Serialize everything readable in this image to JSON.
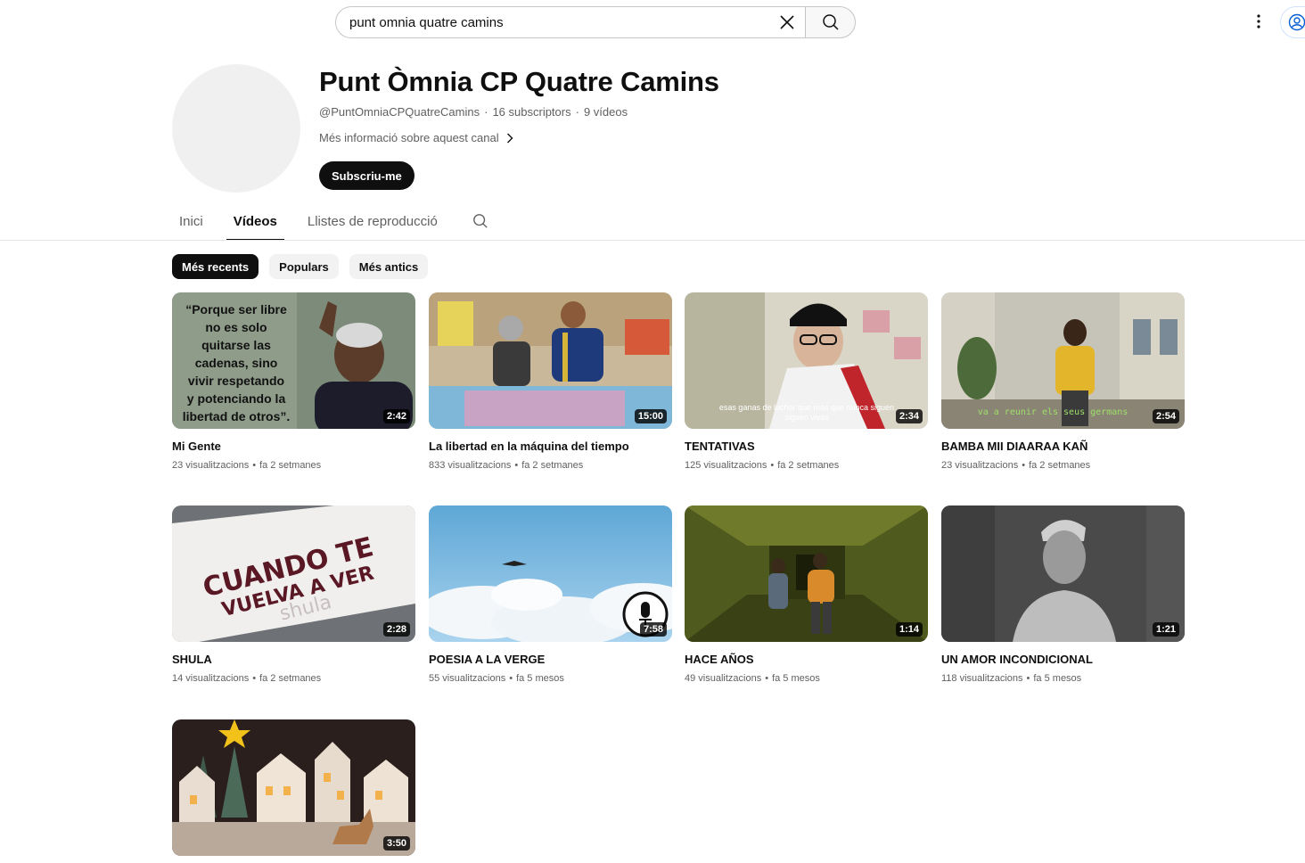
{
  "search": {
    "value": "punt omnia quatre camins"
  },
  "channel": {
    "title": "Punt Òmnia CP Quatre Camins",
    "handle": "@PuntOmniaCPQuatreCamins",
    "subscribers": "16 subscriptors",
    "video_count": "9 vídeos",
    "more_info": "Més informació sobre aquest canal",
    "subscribe_label": "Subscriu-me"
  },
  "tabs": [
    {
      "label": "Inici"
    },
    {
      "label": "Vídeos"
    },
    {
      "label": "Llistes de reproducció"
    }
  ],
  "chips": [
    {
      "label": "Més recents"
    },
    {
      "label": "Populars"
    },
    {
      "label": "Més antics"
    }
  ],
  "videos": [
    {
      "title": "Mi Gente",
      "views": "23 visualitzacions",
      "age": "fa 2 setmanes",
      "duration": "2:42",
      "thumb_text": [
        "“Porque ser libre",
        "no es solo",
        "quitarse las",
        "cadenas, sino",
        "vivir  respetando",
        "y  potenciando la",
        "libertad de otros”."
      ]
    },
    {
      "title": "La libertad en la máquina del tiempo",
      "views": "833 visualitzacions",
      "age": "fa 2 setmanes",
      "duration": "15:00"
    },
    {
      "title": "TENTATIVAS",
      "views": "125 visualitzacions",
      "age": "fa 2 setmanes",
      "duration": "2:34",
      "thumb_text": [
        "esas ganas de luchar que más que nunca siguen",
        "siguen vivas"
      ]
    },
    {
      "title": "BAMBA MII DIAARAA KAÑ",
      "views": "23 visualitzacions",
      "age": "fa 2 setmanes",
      "duration": "2:54",
      "thumb_text": [
        "va a reunir els seus germans"
      ]
    },
    {
      "title": "SHULA",
      "views": "14 visualitzacions",
      "age": "fa 2 setmanes",
      "duration": "2:28",
      "thumb_text": [
        "CUANDO TE",
        "VUELVA A VER",
        "shula"
      ]
    },
    {
      "title": "POESIA A LA VERGE",
      "views": "55 visualitzacions",
      "age": "fa 5 mesos",
      "duration": "7:58"
    },
    {
      "title": "HACE AÑOS",
      "views": "49 visualitzacions",
      "age": "fa 5 mesos",
      "duration": "1:14"
    },
    {
      "title": "UN AMOR INCONDICIONAL",
      "views": "118 visualitzacions",
      "age": "fa 5 mesos",
      "duration": "1:21"
    },
    {
      "duration": "3:50"
    }
  ]
}
